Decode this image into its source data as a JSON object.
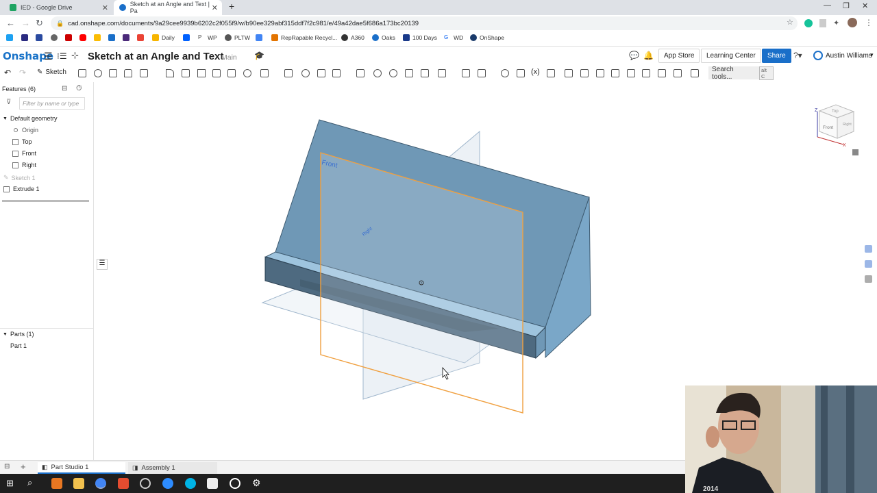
{
  "browser": {
    "tabs": [
      {
        "title": "IED - Google Drive"
      },
      {
        "title": "Sketch at an Angle and Text | Pa"
      }
    ],
    "url": "cad.onshape.com/documents/9a29cee9939b6202c2f055f9/w/b90ee329abf315ddf7f2c981/e/49a42dae5f686a173bc20139",
    "bookmarks": [
      "Daily",
      "WP",
      "PLTW",
      "RepRapable Recycl...",
      "A360",
      "Oaks",
      "100 Days",
      "WD",
      "OnShape"
    ]
  },
  "header": {
    "logo": "Onshape",
    "doc_title": "Sketch at an Angle and Text",
    "branch": "Main",
    "app_store": "App Store",
    "learning_center": "Learning Center",
    "share": "Share",
    "user": "Austin Williams"
  },
  "toolbar": {
    "sketch_label": "Sketch",
    "search_tools": "Search tools...",
    "search_shortcut": "alt C"
  },
  "features": {
    "title": "Features (6)",
    "filter_placeholder": "Filter by name or type",
    "default_geometry": "Default geometry",
    "items": [
      "Origin",
      "Top",
      "Front",
      "Right",
      "Sketch 1",
      "Extrude 1"
    ],
    "parts_title": "Parts (1)",
    "parts": [
      "Part 1"
    ]
  },
  "viewport": {
    "plane_front_label": "Front",
    "plane_right_label": "Right",
    "viewcube": {
      "top": "Top",
      "front": "Front",
      "right": "Right",
      "z": "Z",
      "x": "X"
    }
  },
  "bottom_tabs": [
    "Part Studio 1",
    "Assembly 1"
  ],
  "webcam": {
    "shirt_text": "2014"
  },
  "colors": {
    "accent": "#1a6fc9",
    "part": "#6f98b6",
    "front_plane": "#f0a040"
  }
}
